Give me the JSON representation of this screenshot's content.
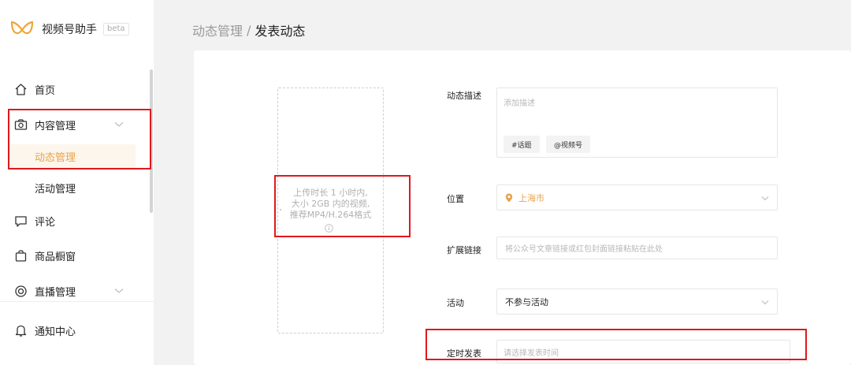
{
  "app": {
    "name": "视频号助手",
    "badge": "beta",
    "accent_color": "#e8a34d",
    "highlight_color": "#e0181c"
  },
  "sidebar": {
    "items": [
      {
        "label": "首页",
        "icon": "home-icon"
      },
      {
        "label": "内容管理",
        "icon": "camera-icon",
        "expandable": true,
        "expanded": true
      },
      {
        "label": "动态管理",
        "sub": true,
        "active": true
      },
      {
        "label": "活动管理",
        "sub": true
      },
      {
        "label": "评论",
        "icon": "comment-icon"
      },
      {
        "label": "商品橱窗",
        "icon": "shopping-bag-icon"
      },
      {
        "label": "直播管理",
        "icon": "live-icon",
        "expandable": true
      },
      {
        "label": "通知中心",
        "icon": "bell-icon"
      }
    ]
  },
  "breadcrumb": {
    "parent": "动态管理",
    "separator": "/",
    "current": "发表动态"
  },
  "upload": {
    "line1": "上传时长 1 小时内,",
    "line2": "大小 2GB 内的视频,",
    "line3": "推荐MP4/H.264格式",
    "icon": "info-icon"
  },
  "form": {
    "description": {
      "label": "动态描述",
      "placeholder": "添加描述",
      "topic_button": "#话题",
      "mention_button": "@视频号"
    },
    "location": {
      "label": "位置",
      "value": "上海市",
      "icon": "location-pin-icon"
    },
    "link": {
      "label": "扩展链接",
      "placeholder": "将公众号文章链接或红包封面链接粘贴在此处"
    },
    "activity": {
      "label": "活动",
      "value": "不参与活动"
    },
    "schedule": {
      "label": "定时发表",
      "placeholder": "请选择发表时间"
    }
  }
}
